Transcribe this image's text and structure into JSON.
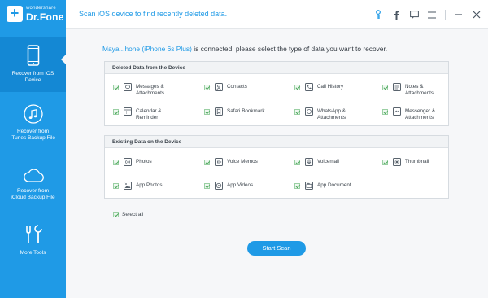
{
  "brand": {
    "small": "wondershare",
    "name": "Dr.Fone"
  },
  "sidebar": {
    "items": [
      {
        "label_1": "Recover from iOS",
        "label_2": "Device",
        "icon": "phone-icon",
        "active": true
      },
      {
        "label_1": "Recover from",
        "label_2": "iTunes Backup File",
        "icon": "music-note-icon",
        "active": false
      },
      {
        "label_1": "Recover from",
        "label_2": "iCloud Backup File",
        "icon": "cloud-icon",
        "active": false
      },
      {
        "label_1": "More Tools",
        "label_2": "",
        "icon": "tools-icon",
        "active": false
      }
    ]
  },
  "header": {
    "title": "Scan iOS device to find recently deleted data.",
    "icons": [
      "key-icon",
      "facebook-icon",
      "feedback-icon",
      "menu-icon",
      "minimize-icon",
      "close-icon"
    ]
  },
  "main": {
    "device_name": "Maya...hone (iPhone 6s Plus)",
    "connected_suffix": " is connected, please select the type of data you want to recover.",
    "deleted_section": {
      "title": "Deleted Data from the Device",
      "items": [
        {
          "line1": "Messages &",
          "line2": "Attachments",
          "icon": "message-icon",
          "checked": true
        },
        {
          "line1": "Contacts",
          "line2": "",
          "icon": "contacts-icon",
          "checked": true
        },
        {
          "line1": "Call History",
          "line2": "",
          "icon": "phone-call-icon",
          "checked": true
        },
        {
          "line1": "Notes &",
          "line2": "Attachments",
          "icon": "notes-icon",
          "checked": true
        },
        {
          "line1": "Calendar &",
          "line2": "Reminder",
          "icon": "calendar-icon",
          "checked": true
        },
        {
          "line1": "Safari Bookmark",
          "line2": "",
          "icon": "bookmark-icon",
          "checked": true
        },
        {
          "line1": "WhatsApp &",
          "line2": "Attachments",
          "icon": "whatsapp-icon",
          "checked": true
        },
        {
          "line1": "Messenger &",
          "line2": "Attachments",
          "icon": "messenger-icon",
          "checked": true
        }
      ]
    },
    "existing_section": {
      "title": "Existing Data on the Device",
      "items": [
        {
          "line1": "Photos",
          "line2": "",
          "icon": "photo-icon",
          "checked": true
        },
        {
          "line1": "Voice Memos",
          "line2": "",
          "icon": "voice-memo-icon",
          "checked": true
        },
        {
          "line1": "Voicemail",
          "line2": "",
          "icon": "voicemail-icon",
          "checked": true
        },
        {
          "line1": "Thumbnail",
          "line2": "",
          "icon": "thumbnail-icon",
          "checked": true
        },
        {
          "line1": "App Photos",
          "line2": "",
          "icon": "app-photo-icon",
          "checked": true
        },
        {
          "line1": "App Videos",
          "line2": "",
          "icon": "app-video-icon",
          "checked": true
        },
        {
          "line1": "App Document",
          "line2": "",
          "icon": "app-document-icon",
          "checked": true
        }
      ]
    },
    "select_all_label": "Select all",
    "start_button": "Start Scan"
  },
  "colors": {
    "accent": "#1f9ae6",
    "sidebar_active": "#1488d4",
    "check": "#4ea85d"
  }
}
